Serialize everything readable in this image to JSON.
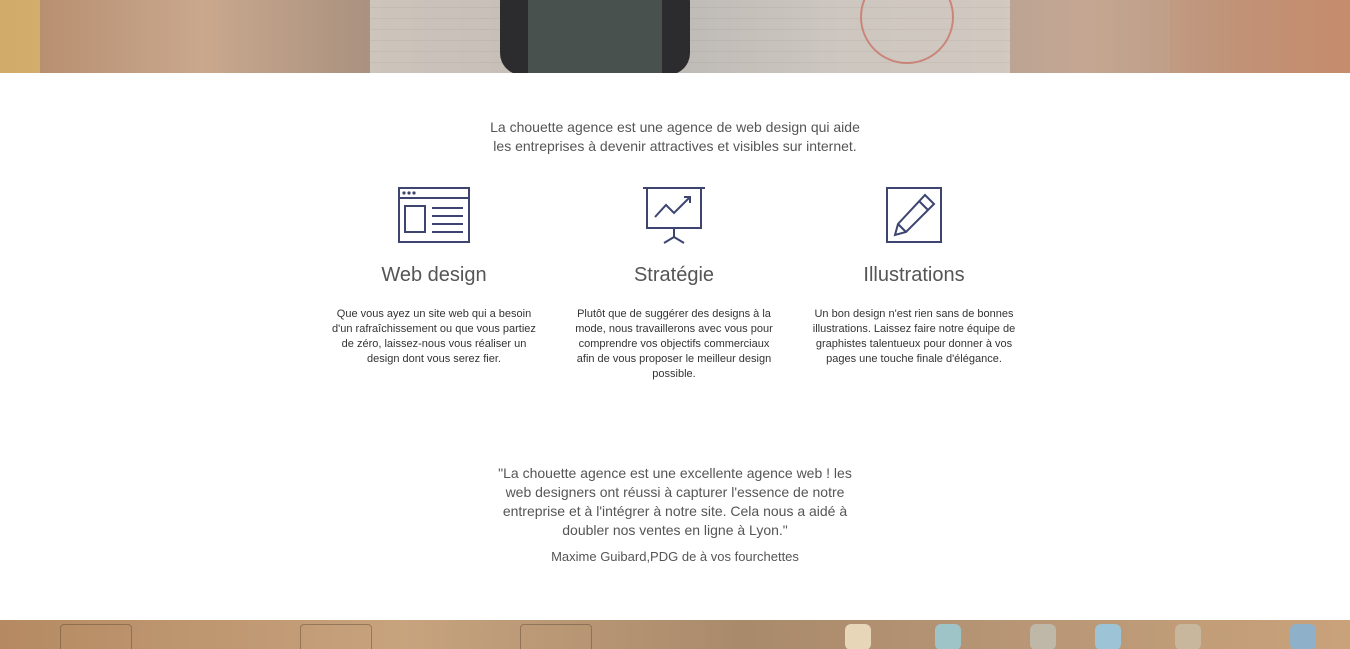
{
  "intro": {
    "line1": "La chouette agence est une agence de web design qui aide",
    "line2": "les entreprises à devenir attractives et visibles sur internet."
  },
  "services": [
    {
      "icon": "web-browser-icon",
      "title": "Web design",
      "description": "Que vous ayez un site web qui a besoin d'un rafraîchissement ou que vous partiez de zéro, laissez-nous vous réaliser un design dont vous serez fier."
    },
    {
      "icon": "presentation-chart-icon",
      "title": "Stratégie",
      "description": "Plutôt que de suggérer des designs à la mode, nous travaillerons avec vous pour comprendre vos objectifs commerciaux afin de vous proposer le meilleur design possible."
    },
    {
      "icon": "pencil-icon",
      "title": "Illustrations",
      "description": "Un bon design n'est rien sans de bonnes illustrations. Laissez faire notre équipe de graphistes talentueux pour donner à vos pages une touche finale d'élégance."
    }
  ],
  "testimonial": {
    "quote": "\"La chouette agence est une excellente agence web ! les web designers ont réussi à capturer l'essence de notre entreprise et à l'intégrer à notre site. Cela nous a aidé à doubler nos ventes en ligne à Lyon.\"",
    "author": "Maxime Guibard,PDG de à vos fourchettes"
  },
  "colors": {
    "icon_stroke": "#3d4470",
    "text": "#555555"
  }
}
